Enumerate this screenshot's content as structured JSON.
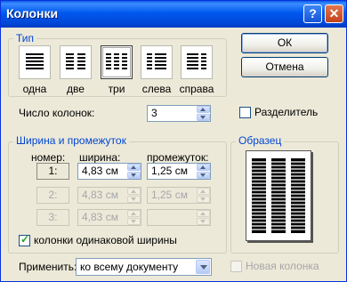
{
  "title": "Колонки",
  "type_group": {
    "legend": "Тип",
    "presets": [
      {
        "label": "одна",
        "underline": "о"
      },
      {
        "label": "две",
        "underline": "д"
      },
      {
        "label": "три",
        "underline": "т"
      },
      {
        "label": "слева",
        "underline": "л"
      },
      {
        "label": "справа",
        "underline": "п"
      }
    ],
    "selected": "три"
  },
  "buttons": {
    "ok": "ОК",
    "cancel": "Отмена"
  },
  "num_columns": {
    "label": "Число колонок:",
    "value": "3"
  },
  "separator": {
    "label": "Разделитель",
    "checked": false
  },
  "width_group": {
    "legend": "Ширина и промежуток",
    "headers": {
      "number": "номер:",
      "width": "ширина:",
      "spacing": "промежуток:"
    },
    "rows": [
      {
        "number": "1:",
        "width": "4,83 см",
        "spacing": "1,25 см",
        "enabled": true
      },
      {
        "number": "2:",
        "width": "4,83 см",
        "spacing": "1,25 см",
        "enabled": false
      },
      {
        "number": "3:",
        "width": "4,83 см",
        "spacing": "",
        "enabled": false
      }
    ]
  },
  "equal_width": {
    "label": "колонки одинаковой ширины",
    "checked": true
  },
  "preview_group": {
    "legend": "Образец"
  },
  "apply": {
    "label": "Применить:",
    "value": "ко всему документу"
  },
  "new_column": {
    "label": "Новая колонка",
    "checked": false,
    "enabled": false
  },
  "colors": {
    "title_bar": "#0058ee",
    "dialog_bg": "#ece9d8",
    "legend_text": "#0046d5"
  },
  "icons": [
    "help-icon",
    "close-icon"
  ]
}
